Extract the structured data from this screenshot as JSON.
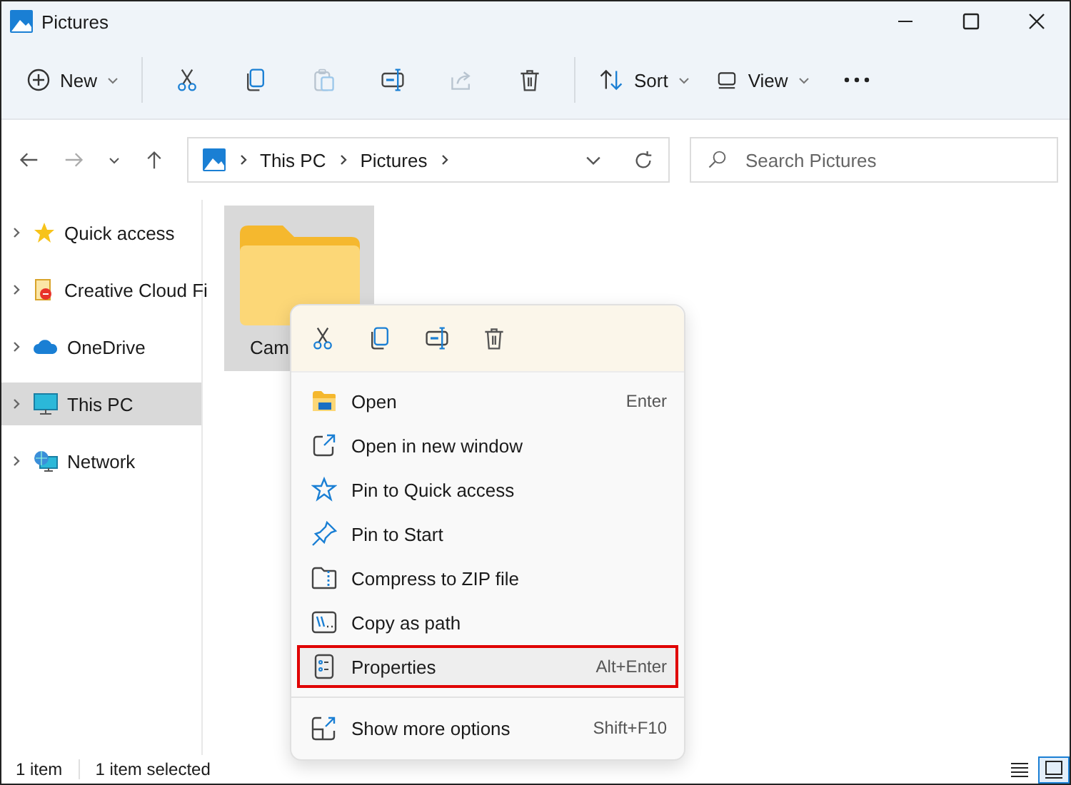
{
  "window": {
    "title": "Pictures"
  },
  "toolbar": {
    "new": {
      "label": "New"
    },
    "actions": [
      {
        "disabled": false
      },
      {
        "disabled": false
      },
      {
        "disabled": true
      },
      {
        "disabled": false
      },
      {
        "disabled": true
      },
      {
        "disabled": false
      }
    ],
    "sort": {
      "label": "Sort"
    },
    "view": {
      "label": "View"
    }
  },
  "address": {
    "segments": [
      "This PC",
      "Pictures"
    ]
  },
  "search": {
    "placeholder": "Search Pictures"
  },
  "sidebar": {
    "items": [
      {
        "label": "Quick access",
        "selected": false
      },
      {
        "label": "Creative Cloud Fi",
        "selected": false
      },
      {
        "label": "OneDrive",
        "selected": false
      },
      {
        "label": "This PC",
        "selected": true
      },
      {
        "label": "Network",
        "selected": false
      }
    ]
  },
  "folder": {
    "name": "Cam",
    "selected": true
  },
  "context_menu": {
    "items": [
      {
        "label": "Open",
        "shortcut": "Enter",
        "highlighted": false
      },
      {
        "label": "Open in new window",
        "highlighted": false
      },
      {
        "label": "Pin to Quick access",
        "highlighted": false
      },
      {
        "label": "Pin to Start",
        "highlighted": false
      },
      {
        "label": "Compress to ZIP file",
        "highlighted": false
      },
      {
        "label": "Copy as path",
        "highlighted": false
      },
      {
        "label": "Properties",
        "shortcut": "Alt+Enter",
        "highlighted": true
      }
    ],
    "more": {
      "label": "Show more options",
      "shortcut": "Shift+F10"
    }
  },
  "status_bar": {
    "count": "1 item",
    "selection": "1 item selected",
    "views": [
      {
        "selected": false
      },
      {
        "selected": true
      }
    ]
  }
}
